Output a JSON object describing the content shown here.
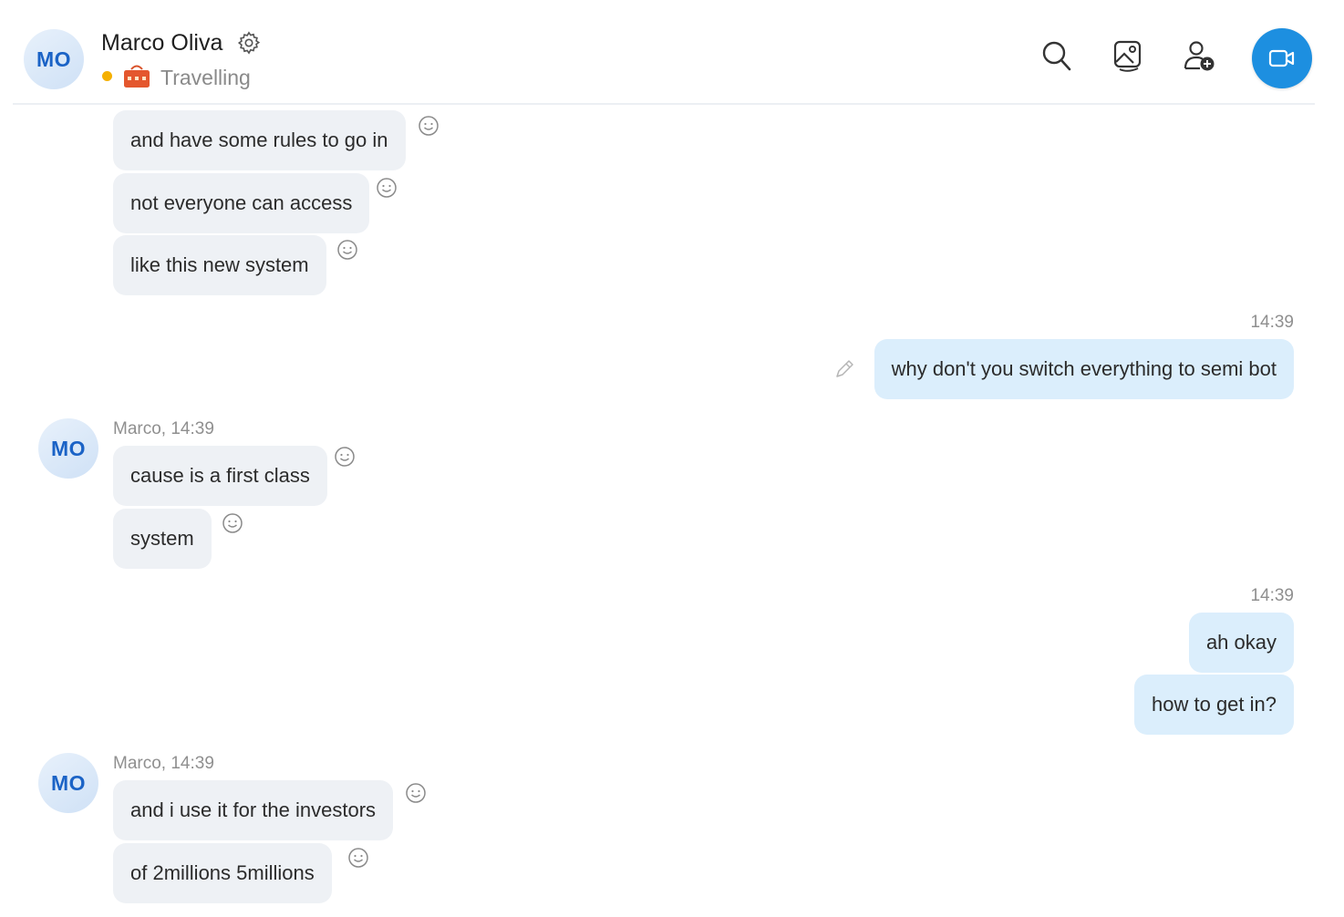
{
  "header": {
    "avatar_initials": "MO",
    "contact_name": "Marco Oliva",
    "status_text": "Travelling",
    "status_color": "#f5b000",
    "icons": [
      "gear-icon",
      "suitcase-icon",
      "search-icon",
      "gallery-icon",
      "add-person-icon",
      "video-call-icon"
    ],
    "accent_color": "#1d8fe0"
  },
  "messages": {
    "group1": {
      "bubbles": [
        "and have some rules to go in",
        "not everyone can access",
        "like this new system"
      ]
    },
    "out1": {
      "time": "14:39",
      "bubbles": [
        "why don't you switch everything to semi bot"
      ]
    },
    "group2": {
      "avatar_initials": "MO",
      "meta": "Marco, 14:39",
      "bubbles": [
        "cause is a first class",
        "system"
      ]
    },
    "out2": {
      "time": "14:39",
      "bubbles": [
        "ah okay",
        "how to get in?"
      ]
    },
    "group3": {
      "avatar_initials": "MO",
      "meta": "Marco, 14:39",
      "bubbles": [
        "and i use it for the investors",
        "of 2millions 5millions"
      ]
    }
  },
  "colors": {
    "incoming_bubble": "#eef1f5",
    "outgoing_bubble": "#dbeefc"
  }
}
